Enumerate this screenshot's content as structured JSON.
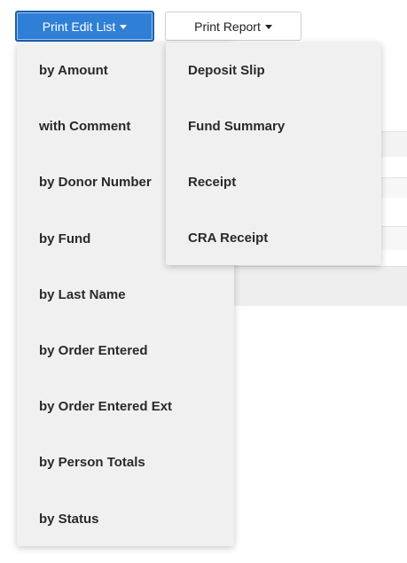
{
  "toolbar": {
    "print_edit_list_label": "Print Edit List",
    "print_report_label": "Print Report"
  },
  "edit_list_menu": {
    "items": [
      {
        "label": "by Amount"
      },
      {
        "label": "with Comment"
      },
      {
        "label": "by Donor Number"
      },
      {
        "label": "by Fund"
      },
      {
        "label": "by Last Name"
      },
      {
        "label": "by Order Entered"
      },
      {
        "label": "by Order Entered Ext"
      },
      {
        "label": "by Person Totals"
      },
      {
        "label": "by Status"
      }
    ]
  },
  "report_menu": {
    "items": [
      {
        "label": "Deposit Slip"
      },
      {
        "label": "Fund Summary"
      },
      {
        "label": "Receipt"
      },
      {
        "label": "CRA Receipt"
      }
    ]
  },
  "colors": {
    "primary_button": "#2f7fd6",
    "primary_button_border": "#1a5fae",
    "menu_background": "#f0f0f0",
    "menu_text": "#2a2a2a"
  },
  "icons": {
    "dropdown": "caret-down-icon"
  }
}
